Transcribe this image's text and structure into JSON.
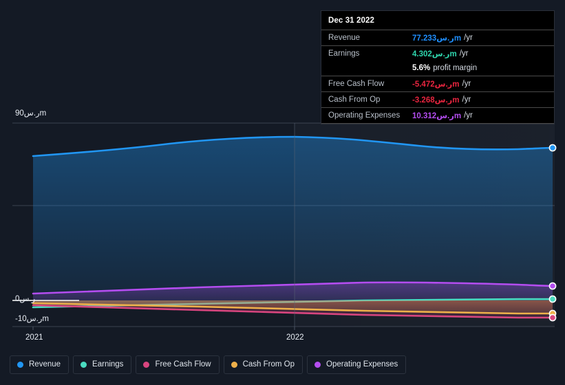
{
  "currency_symbol": "ر.س",
  "colors": {
    "background": "#141a25",
    "revenue": "#2196f3",
    "earnings": "#4adbc0",
    "free_cash_flow": "#d9457f",
    "cash_from_op": "#eeb04a",
    "operating_expenses": "#b44df0",
    "tooltip_background": "#000000",
    "zero_line": "#ffffff",
    "gridline": "#3a4250"
  },
  "tooltip": {
    "title": "Dec 31 2022",
    "rows": [
      {
        "label": "Revenue",
        "value": "77.233ر.سm",
        "unit": "/yr",
        "color": "#1f8fff"
      },
      {
        "label": "Earnings",
        "value": "4.302ر.سm",
        "unit": "/yr",
        "color": "#2fd6ae"
      },
      {
        "label": "Free Cash Flow",
        "value": "-5.472ر.سm",
        "unit": "/yr",
        "color": "#e8253f"
      },
      {
        "label": "Cash From Op",
        "value": "-3.268ر.سm",
        "unit": "/yr",
        "color": "#e8253f"
      },
      {
        "label": "Operating Expenses",
        "value": "10.312ر.سm",
        "unit": "/yr",
        "color": "#b44df0"
      }
    ],
    "profit_margin": {
      "value": "5.6%",
      "text": "profit margin"
    }
  },
  "axis": {
    "y_labels": [
      {
        "text": "90ر.سm",
        "value": 90
      },
      {
        "text": "0ر.س",
        "value": 0
      },
      {
        "text": "-10ر.سm",
        "value": -10
      }
    ],
    "x_labels": [
      "2021",
      "2022"
    ]
  },
  "legend": [
    {
      "label": "Revenue",
      "color": "#2196f3"
    },
    {
      "label": "Earnings",
      "color": "#4adbc0"
    },
    {
      "label": "Free Cash Flow",
      "color": "#d9457f"
    },
    {
      "label": "Cash From Op",
      "color": "#eeb04a"
    },
    {
      "label": "Operating Expenses",
      "color": "#b44df0"
    }
  ],
  "chart_data": {
    "type": "area",
    "title": "",
    "xlabel": "",
    "ylabel": "",
    "ylim": [
      -10,
      90
    ],
    "grid": true,
    "legend_position": "bottom",
    "x": [
      "2021-01",
      "2021-04",
      "2021-07",
      "2021-10",
      "2022-01",
      "2022-04",
      "2022-07",
      "2022-10",
      "2022-12"
    ],
    "x_tick_positions": [
      "2021",
      "2022"
    ],
    "series": [
      {
        "name": "Revenue",
        "color": "#2196f3",
        "values": [
          73.3,
          75.2,
          77.0,
          78.6,
          79.9,
          79.3,
          77.6,
          76.9,
          77.233
        ]
      },
      {
        "name": "Earnings",
        "color": "#4adbc0",
        "values": [
          -3.4,
          -2.9,
          -2.2,
          -1.4,
          -0.6,
          0.6,
          1.9,
          3.2,
          4.302
        ]
      },
      {
        "name": "Free Cash Flow",
        "color": "#d9457f",
        "values": [
          -2.6,
          -2.9,
          -3.2,
          -3.6,
          -4.0,
          -4.4,
          -4.8,
          -5.2,
          -5.472
        ]
      },
      {
        "name": "Cash From Op",
        "color": "#eeb04a",
        "values": [
          -1.3,
          -1.6,
          -1.9,
          -2.2,
          -2.5,
          -2.8,
          -3.0,
          -3.2,
          -3.268
        ]
      },
      {
        "name": "Operating Expenses",
        "color": "#b44df0",
        "values": [
          3.6,
          4.7,
          5.9,
          7.0,
          8.2,
          9.0,
          9.7,
          10.1,
          10.312
        ]
      }
    ]
  }
}
